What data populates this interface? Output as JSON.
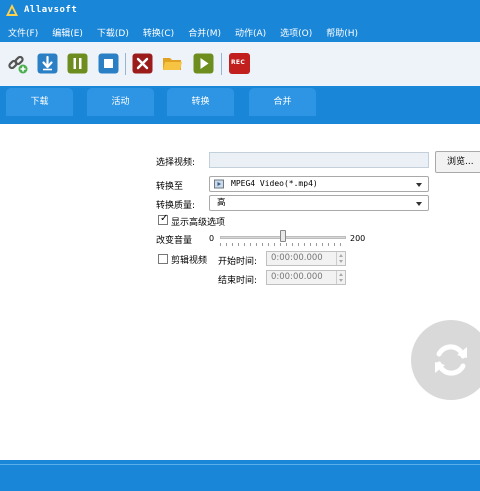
{
  "app": {
    "title": "Allavsoft"
  },
  "menu": [
    "文件(F)",
    "编辑(E)",
    "下载(D)",
    "转换(C)",
    "合并(M)",
    "动作(A)",
    "选项(O)",
    "帮助(H)"
  ],
  "toolbar": {
    "icons": [
      "add-link-icon",
      "download-icon",
      "pause-icon",
      "stop-icon",
      "delete-icon",
      "open-folder-icon",
      "play-icon",
      "record-icon"
    ],
    "rec_label": "REC"
  },
  "tabs": [
    "下载",
    "活动",
    "转换",
    "合并"
  ],
  "active_tab": "转换",
  "form": {
    "select_video_label": "选择视频:",
    "select_video_value": "",
    "browse_label": "浏览...",
    "convert_to_label": "转换至",
    "convert_to_value": "MPEG4 Video(*.mp4)",
    "quality_label": "转换质量:",
    "quality_value": "高",
    "show_advanced_label": "显示高级选项",
    "show_advanced_checked": true,
    "volume_label": "改变音量",
    "volume_min": "0",
    "volume_max": "200",
    "volume_value": 0.5,
    "trim_label": "剪辑视频",
    "trim_checked": false,
    "start_time_label": "开始时间:",
    "start_time_value": "0:00:00.000",
    "end_time_label": "结束时间:",
    "end_time_value": "0:00:00.000"
  },
  "convert_button": {
    "icon": "convert-refresh-icon"
  },
  "colors": {
    "accent": "#1a86d8",
    "accent_light": "#2e95e4",
    "convert_button": "#d9d9d9"
  }
}
